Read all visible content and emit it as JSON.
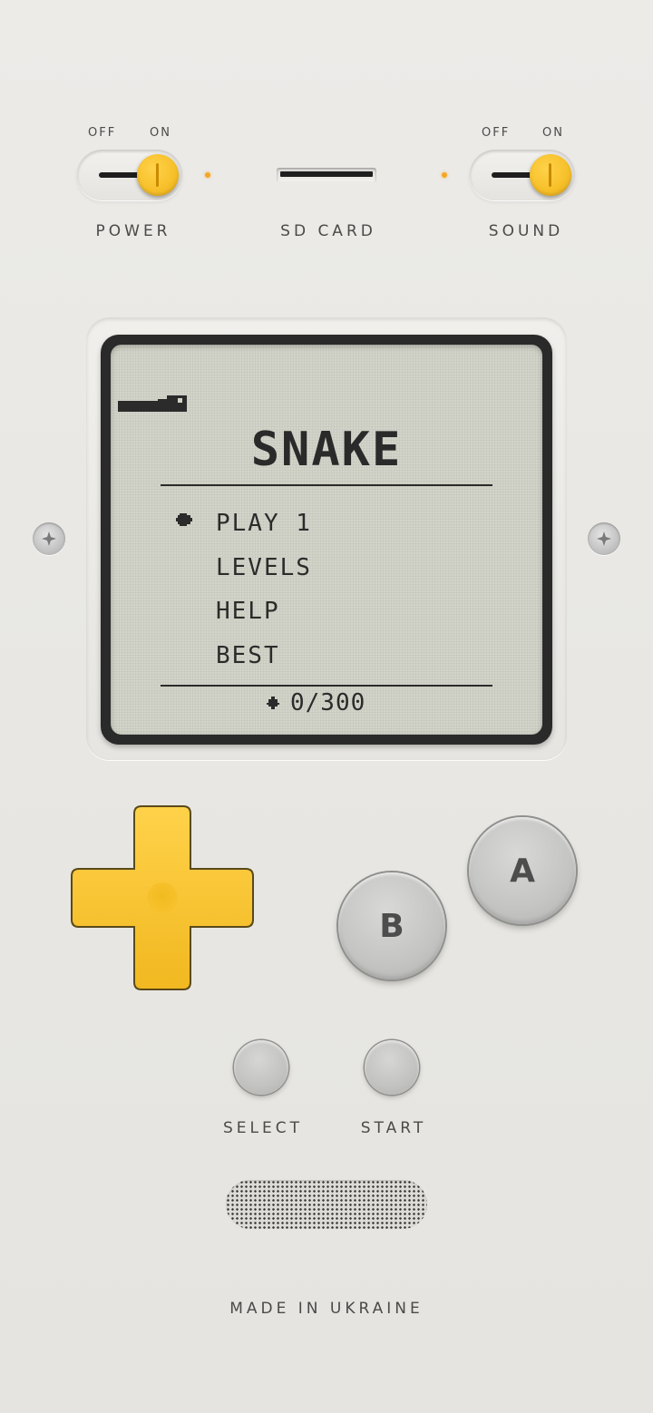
{
  "power_switch": {
    "off_label": "OFF",
    "on_label": "ON",
    "label": "POWER",
    "state": "on"
  },
  "sd_card": {
    "label": "SD CARD"
  },
  "sound_switch": {
    "off_label": "OFF",
    "on_label": "ON",
    "label": "SOUND",
    "state": "on"
  },
  "screen": {
    "title": "SNAKE",
    "menu": [
      {
        "label": "PLAY 1",
        "selected": true
      },
      {
        "label": "LEVELS",
        "selected": false
      },
      {
        "label": "HELP",
        "selected": false
      },
      {
        "label": "BEST",
        "selected": false
      }
    ],
    "score": "0/300",
    "background_color": "#d3d4c9",
    "ink_color": "#2b2b2b"
  },
  "buttons": {
    "a_label": "A",
    "b_label": "B",
    "select_label": "SELECT",
    "start_label": "START"
  },
  "colors": {
    "accent": "#f7c12c",
    "body": "#e8e7e3",
    "led": "#f5a623"
  },
  "footer": {
    "made_in": "MADE IN UKRAINE"
  }
}
